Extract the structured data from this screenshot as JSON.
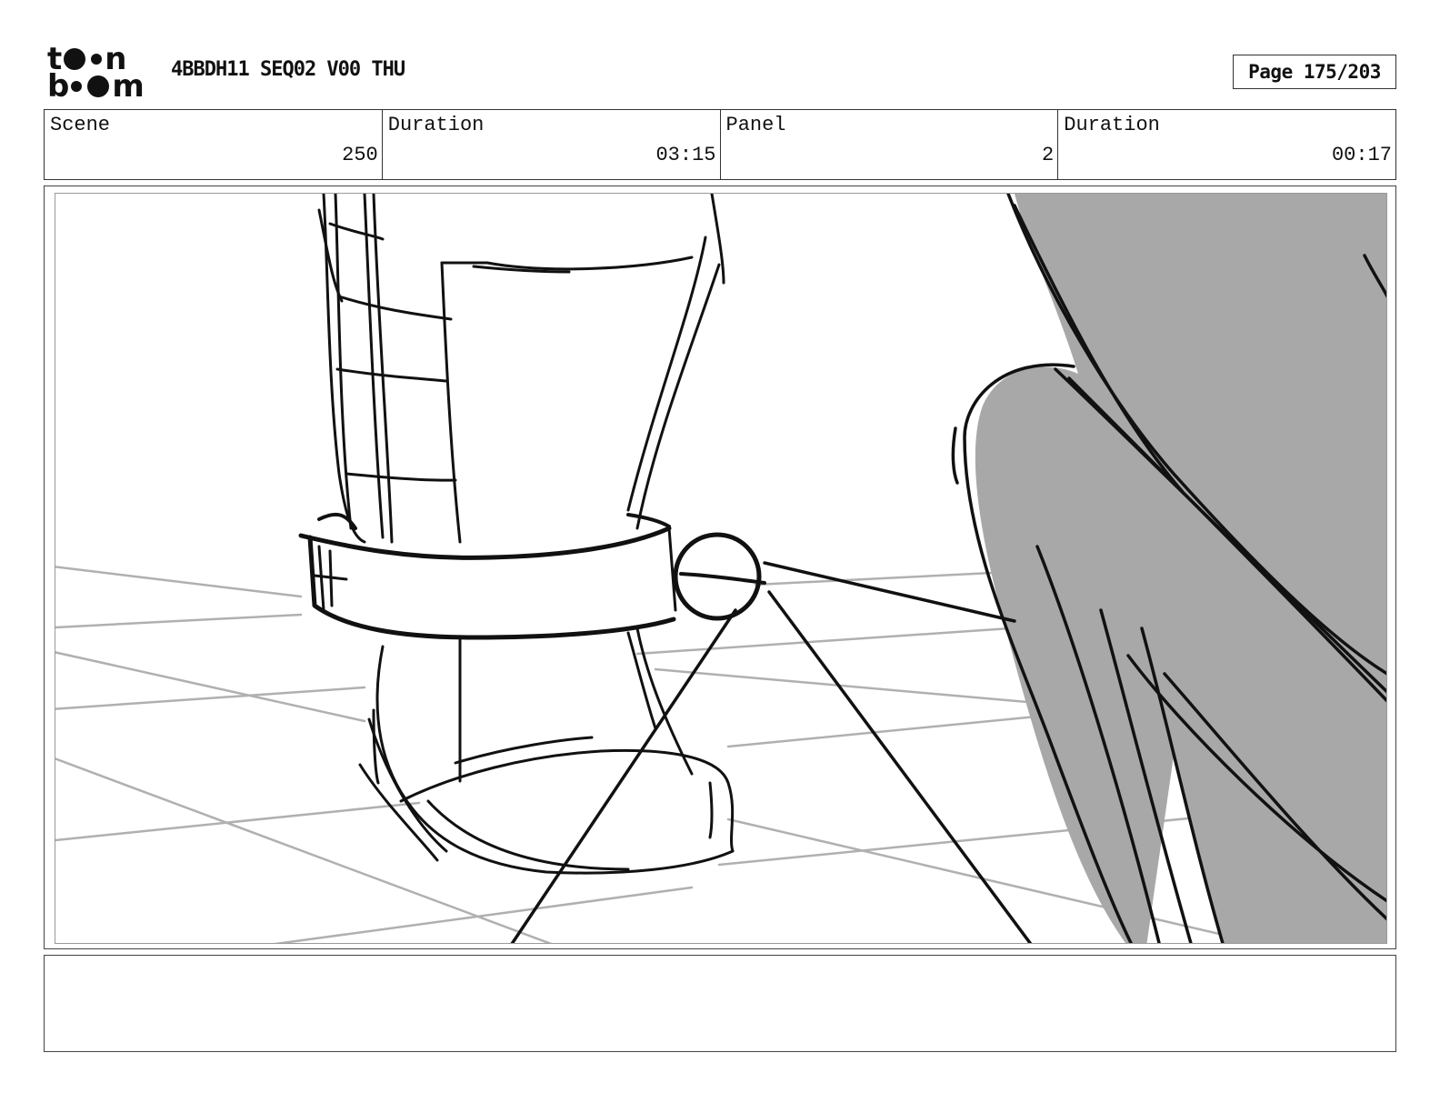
{
  "header": {
    "logo_top": "t",
    "logo_top_end": "n",
    "logo_bottom": "b",
    "logo_bottom_end": "m",
    "project_title": "4BBDH11 SEQ02 V00 THU",
    "page_label": "Page 175/203"
  },
  "info": {
    "scene_label": "Scene",
    "scene_value": "250",
    "scene_duration_label": "Duration",
    "scene_duration_value": "03:15",
    "panel_label": "Panel",
    "panel_value": "2",
    "panel_duration_label": "Duration",
    "panel_duration_value": "00:17"
  },
  "notes": {
    "text": ""
  },
  "colors": {
    "ink": "#111111",
    "floor_lines": "#b0b0b0",
    "shadow_fill": "#a8a8a8",
    "border": "#333333"
  }
}
